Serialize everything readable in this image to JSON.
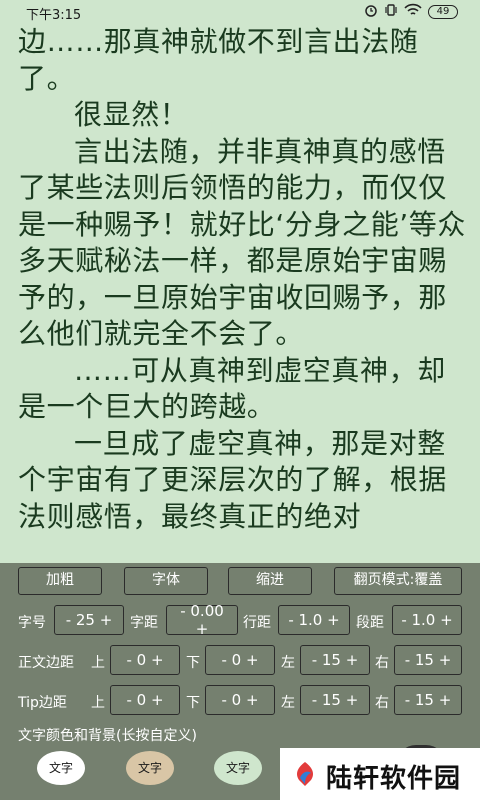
{
  "status": {
    "time": "下午3:15",
    "battery": "49"
  },
  "reader": {
    "paragraphs": [
      "边……那真神就做不到言出法随了。",
      "很显然！",
      "言出法随，并非真神真的感悟了某些法则后领悟的能力，而仅仅是一种赐予！就好比‘分身之能’等众多天赋秘法一样，都是原始宇宙赐予的，一旦原始宇宙收回赐予，那么他们就完全不会了。",
      "……可从真神到虚空真神，却是一个巨大的跨越。",
      "一旦成了虚空真神，那是对整个宇宙有了更深层次的了解，根据法则感悟，最终真正的绝对"
    ]
  },
  "panel": {
    "buttons": {
      "bold": "加粗",
      "font": "字体",
      "indent": "缩进",
      "page_mode": "翻页模式:覆盖"
    },
    "font_size": {
      "label": "字号",
      "value": "- 25 +"
    },
    "char_spacing": {
      "label": "字距",
      "value": "- 0.00 +"
    },
    "line_spacing": {
      "label": "行距",
      "value": "- 1.0 +"
    },
    "para_spacing": {
      "label": "段距",
      "value": "- 1.0 +"
    },
    "body_margin": {
      "label": "正文边距",
      "top": {
        "label": "上",
        "value": "- 0 +"
      },
      "bottom": {
        "label": "下",
        "value": "- 0 +"
      },
      "left": {
        "label": "左",
        "value": "- 15 +"
      },
      "right": {
        "label": "右",
        "value": "- 15 +"
      }
    },
    "tip_margin": {
      "label": "Tip边距",
      "top": {
        "label": "上",
        "value": "- 0 +"
      },
      "bottom": {
        "label": "下",
        "value": "- 0 +"
      },
      "left": {
        "label": "左",
        "value": "- 15 +"
      },
      "right": {
        "label": "右",
        "value": "- 15 +"
      }
    },
    "color_title": "文字颜色和背景(长按自定义)",
    "swatches": [
      {
        "label": "文字",
        "bg": "#ffffff"
      },
      {
        "label": "文字",
        "bg": "#d9c6a6"
      },
      {
        "label": "文字",
        "bg": "#cfe6cd"
      }
    ]
  },
  "watermark": {
    "text": "陆轩软件园"
  },
  "colors": {
    "page_bg": "#cfe6cd",
    "text": "#1a3a1f",
    "panel_bg": "#75806f"
  }
}
